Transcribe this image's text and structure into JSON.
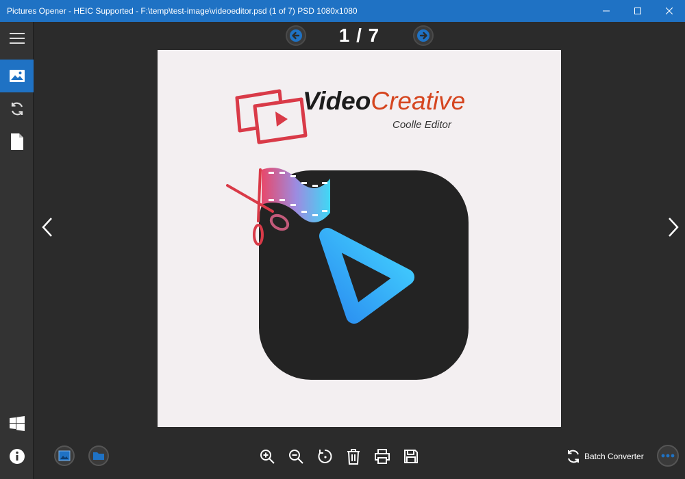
{
  "window": {
    "title": "Pictures Opener - HEIC Supported - F:\\temp\\test-image\\videoeditor.psd (1 of 7) PSD 1080x1080",
    "controls": [
      "minimize",
      "maximize",
      "close"
    ]
  },
  "sidebar": {
    "items": [
      {
        "name": "menu",
        "icon": "hamburger-icon"
      },
      {
        "name": "viewer",
        "icon": "image-icon",
        "active": true
      },
      {
        "name": "converter",
        "icon": "sync-icon"
      },
      {
        "name": "document",
        "icon": "file-icon"
      }
    ],
    "bottom": [
      {
        "name": "windows",
        "icon": "windows-icon"
      },
      {
        "name": "about",
        "icon": "info-icon"
      }
    ]
  },
  "pager": {
    "counter": "1 / 7",
    "prev_icon": "arrow-left-icon",
    "next_icon": "arrow-right-icon"
  },
  "image": {
    "brand_word1": "Video",
    "brand_word2": "Creative",
    "tagline": "Coolle Editor",
    "colors": {
      "background": "#f3eff1",
      "brand_red": "#d93a48",
      "brand_orange": "#d5451f",
      "tile": "#232323",
      "play_gradient_start": "#2a8cf0",
      "play_gradient_end": "#44d4ff"
    }
  },
  "toolbar": {
    "left": [
      "open-image-icon",
      "open-folder-icon"
    ],
    "center": [
      "zoom-in-icon",
      "zoom-out-icon",
      "rotate-icon",
      "delete-icon",
      "print-icon",
      "save-icon"
    ],
    "batch_label": "Batch Converter",
    "more_icon": "more-icon"
  },
  "colors": {
    "accent": "#1f72c4",
    "background": "#2b2b2b",
    "sidebar": "#333333"
  }
}
